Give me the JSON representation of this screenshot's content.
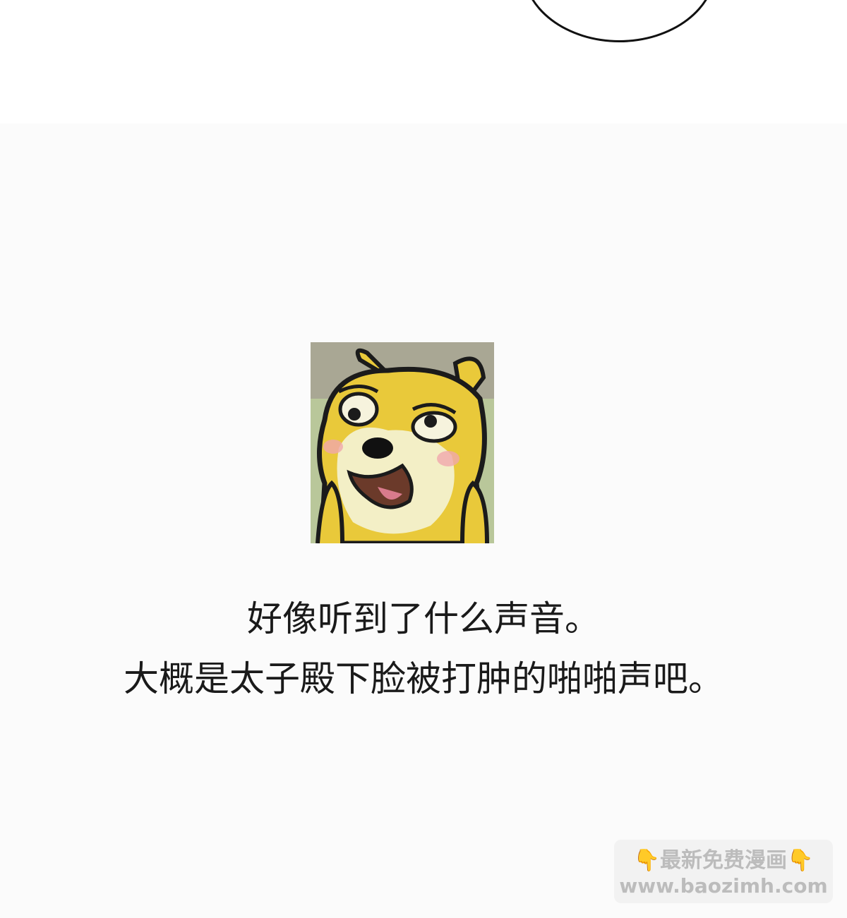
{
  "panel_top": {
    "speech_bubble": "speech-bubble-outline"
  },
  "panel_main": {
    "image": {
      "icon": "doge-meme-image",
      "colors": {
        "fur": "#e9c93a",
        "muzzle": "#f4efc4",
        "background": "#a8a693"
      }
    },
    "caption_line_1": "好像听到了什么声音。",
    "caption_line_2": "大概是太子殿下脸被打肿的啪啪声吧。"
  },
  "watermark": {
    "hand_icon": "pointing-down-hand-icon",
    "hand_left": "👇",
    "line_1": "最新免费漫画",
    "hand_right": "👇",
    "line_2": "www.baozimh.com"
  }
}
